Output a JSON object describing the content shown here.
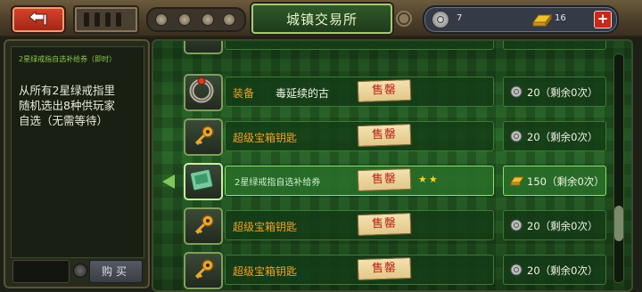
{
  "header": {
    "title": "城镇交易所",
    "silver_amount": "7",
    "gold_amount": "16",
    "plus_label": "+"
  },
  "left_panel": {
    "item_name": "2星绿戒指自选补给券（即时）",
    "description": "从所有2星绿戒指里随机选出8种供玩家自选（无需等待）",
    "buy_label": "购买"
  },
  "shop_items": [
    {
      "name": "装备",
      "sub_name": "毒延续的古",
      "sold_label": "售罄",
      "price": "20（剩余0次）",
      "currency": "silver-coin",
      "icon": "ring-icon"
    },
    {
      "name": "超级宝箱钥匙",
      "sold_label": "售罄",
      "price": "20（剩余0次）",
      "currency": "silver-coin",
      "icon": "key-icon"
    },
    {
      "name": "2星绿戒指自选补给券",
      "sold_label": "售罄",
      "stars": "★★",
      "price": "150（剩余0次）",
      "currency": "gold-bar",
      "icon": "voucher-icon",
      "selected": true
    },
    {
      "name": "超级宝箱钥匙",
      "sold_label": "售罄",
      "price": "20（剩余0次）",
      "currency": "silver-coin",
      "icon": "key-icon"
    },
    {
      "name": "超级宝箱钥匙",
      "sold_label": "售罄",
      "price": "20（剩余0次）",
      "currency": "silver-coin",
      "icon": "key-icon"
    }
  ],
  "colors": {
    "item_name": "#f0a028",
    "sold_text": "#b8221a",
    "star": "#f8d030"
  }
}
